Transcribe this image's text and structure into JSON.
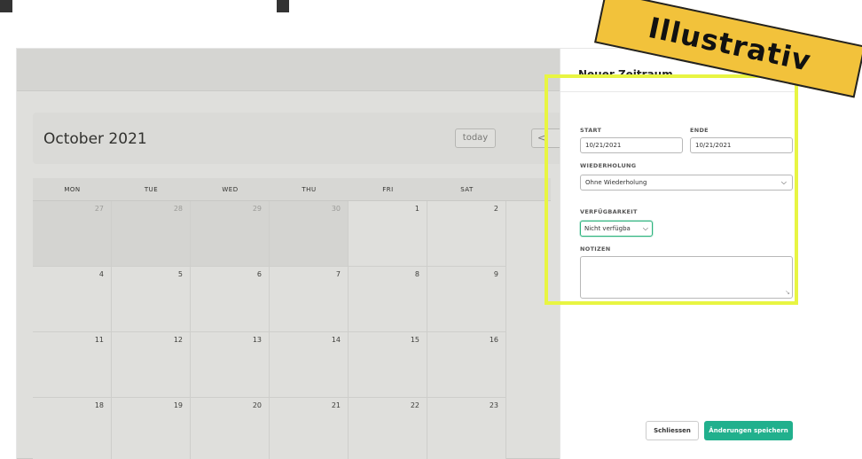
{
  "calendar": {
    "title": "October 2021",
    "today_label": "today",
    "prev_label": "<",
    "weekdays": [
      "MON",
      "TUE",
      "WED",
      "THU",
      "FRI",
      "SAT"
    ],
    "weeks": [
      [
        "27",
        "28",
        "29",
        "30",
        "1",
        "2"
      ],
      [
        "4",
        "5",
        "6",
        "7",
        "8",
        "9"
      ],
      [
        "11",
        "12",
        "13",
        "14",
        "15",
        "16"
      ],
      [
        "18",
        "19",
        "20",
        "21",
        "22",
        "23"
      ]
    ]
  },
  "panel": {
    "title": "Neuer Zeitraum",
    "start_label": "START",
    "start_value": "10/21/2021",
    "end_label": "ENDE",
    "end_value": "10/21/2021",
    "repeat_label": "WIEDERHOLUNG",
    "repeat_value": "Ohne Wiederholung",
    "availability_label": "VERFÜGBARKEIT",
    "availability_value": "Nicht verfügba",
    "notes_label": "NOTIZEN",
    "notes_value": "",
    "close_label": "Schliessen",
    "save_label": "Änderungen speichern"
  },
  "banner": {
    "text": "Illustrativ"
  },
  "colors": {
    "accent_green": "#21b08d",
    "highlight_yellow": "#e8f542",
    "banner_yellow": "#f2c23b"
  }
}
